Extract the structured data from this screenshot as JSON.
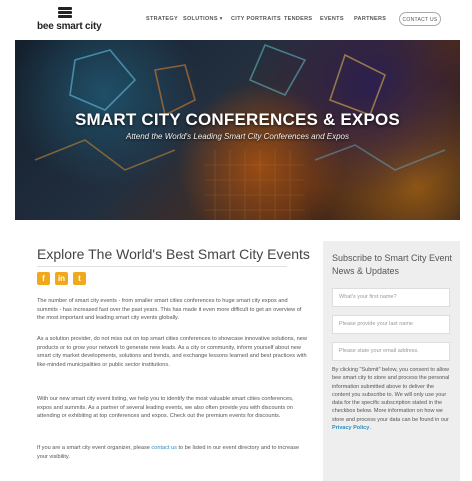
{
  "header": {
    "logo_text": "bee smart city",
    "nav": [
      {
        "label": "STRATEGY"
      },
      {
        "label": "SOLUTIONS ▾"
      },
      {
        "label": "CITY PORTRAITS"
      },
      {
        "label": "TENDERS"
      },
      {
        "label": "EVENTS"
      },
      {
        "label": "PARTNERS"
      }
    ],
    "contact_label": "CONTACT US"
  },
  "hero": {
    "title": "SMART CITY CONFERENCES & EXPOS",
    "subtitle": "Attend the World's Leading Smart City Conferences and Expos"
  },
  "main": {
    "title": "Explore The World's Best Smart City Events",
    "social": [
      {
        "icon": "facebook-icon",
        "glyph": "f"
      },
      {
        "icon": "linkedin-icon",
        "glyph": "in"
      },
      {
        "icon": "twitter-icon",
        "glyph": "t"
      }
    ],
    "paragraphs": [
      "The number of smart city events - from smaller smart cities conferences to huge smart city expos and summits - has increased fast over the past years. This has made it even more difficult to get an overview of the most important and leading smart city events globally.",
      "As a solution provider, do not miss out on top smart cities conferences to showcase innovative solutions, new products or to grow your network to generate new leads. As a city or community, inform yourself about new smart city market developments, solutions and trends, and exchange lessons learned and best practices with like-minded municipalities or public sector institutions.",
      "With our new smart city event listing, we help you to identify the most valuable smart cities conferences, expos and summits. As a partner of several leading events, we also often provide you with discounts on attending or exhibiting at top conferences and expos. Check out the premium events for discounts."
    ],
    "last_para_pre": "If you are a smart city event organizer, please ",
    "last_para_link": "contact us",
    "last_para_post": " to be listed in our event directory and to increase your visibility."
  },
  "sidebar": {
    "title": "Subscribe to Smart City Event News & Updates",
    "first_name_placeholder": "What's your first name?",
    "last_name_placeholder": "Please provide your last name",
    "email_placeholder": "Please state your email address.",
    "consent_text": "By clicking \"Submit\" below, you consent to allow bee smart city to store and process the personal information submitted above to deliver the content you subscribe to. We will only use your data for the specific subscription stated in the checkbox below. More information on how we store and process your data can be found in our ",
    "privacy_link": "Privacy Policy",
    "consent_end": "."
  },
  "colors": {
    "accent": "#f0a81c",
    "link": "#2a8fc1",
    "sidebar_bg": "#eeeeee"
  }
}
